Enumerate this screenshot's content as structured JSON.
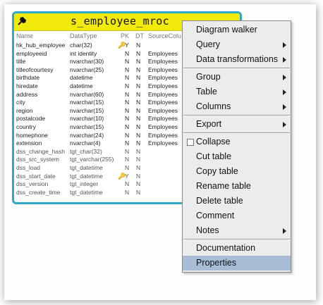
{
  "table": {
    "title": "s_employee_mroc",
    "columns": {
      "name": "Name",
      "datatype": "DataType",
      "pk": "PK",
      "dt": "DT",
      "source": "SourceColu"
    },
    "rows": [
      {
        "name": "hk_hub_employee",
        "type": "char(32)",
        "key": "🔑",
        "pk": "Y",
        "dt": "N",
        "src": ""
      },
      {
        "name": "employeeid",
        "type": "int identity",
        "key": "",
        "pk": "N",
        "dt": "N",
        "src": "Employees"
      },
      {
        "name": "title",
        "type": "nvarchar(30)",
        "key": "",
        "pk": "N",
        "dt": "N",
        "src": "Employees"
      },
      {
        "name": "titleofcourtesy",
        "type": "nvarchar(25)",
        "key": "",
        "pk": "N",
        "dt": "N",
        "src": "Employees"
      },
      {
        "name": "birthdate",
        "type": "datetime",
        "key": "",
        "pk": "N",
        "dt": "N",
        "src": "Employees"
      },
      {
        "name": "hiredate",
        "type": "datetime",
        "key": "",
        "pk": "N",
        "dt": "N",
        "src": "Employees"
      },
      {
        "name": "address",
        "type": "nvarchar(60)",
        "key": "",
        "pk": "N",
        "dt": "N",
        "src": "Employees"
      },
      {
        "name": "city",
        "type": "nvarchar(15)",
        "key": "",
        "pk": "N",
        "dt": "N",
        "src": "Employees"
      },
      {
        "name": "region",
        "type": "nvarchar(15)",
        "key": "",
        "pk": "N",
        "dt": "N",
        "src": "Employees"
      },
      {
        "name": "postalcode",
        "type": "nvarchar(10)",
        "key": "",
        "pk": "N",
        "dt": "N",
        "src": "Employees"
      },
      {
        "name": "country",
        "type": "nvarchar(15)",
        "key": "",
        "pk": "N",
        "dt": "N",
        "src": "Employees"
      },
      {
        "name": "homephone",
        "type": "nvarchar(24)",
        "key": "",
        "pk": "N",
        "dt": "N",
        "src": "Employees"
      },
      {
        "name": "extension",
        "type": "nvarchar(4)",
        "key": "",
        "pk": "N",
        "dt": "N",
        "src": "Employees"
      },
      {
        "name": "dss_change_hash",
        "type": "tgt_char(32)",
        "key": "",
        "pk": "N",
        "dt": "N",
        "src": ""
      },
      {
        "name": "dss_src_system",
        "type": "tgt_varchar(255)",
        "key": "",
        "pk": "N",
        "dt": "N",
        "src": ""
      },
      {
        "name": "dss_load",
        "type": "tgt_datetime",
        "key": "",
        "pk": "N",
        "dt": "N",
        "src": ""
      },
      {
        "name": "dss_start_date",
        "type": "tgt_datetime",
        "key": "🔑",
        "pk": "Y",
        "dt": "N",
        "src": ""
      },
      {
        "name": "dss_version",
        "type": "tgt_integer",
        "key": "",
        "pk": "N",
        "dt": "N",
        "src": ""
      },
      {
        "name": "dss_create_time",
        "type": "tgt_datetime",
        "key": "",
        "pk": "N",
        "dt": "N",
        "src": ""
      }
    ]
  },
  "menu": {
    "items": [
      {
        "label": "Diagram walker",
        "submenu": false
      },
      {
        "label": "Query",
        "submenu": true
      },
      {
        "label": "Data transformations",
        "submenu": true
      },
      {
        "label": "Group",
        "submenu": true
      },
      {
        "label": "Table",
        "submenu": true
      },
      {
        "label": "Columns",
        "submenu": true
      },
      {
        "label": "Export",
        "submenu": true
      },
      {
        "label": "Collapse",
        "submenu": false,
        "checkbox": true
      },
      {
        "label": "Cut table",
        "submenu": false
      },
      {
        "label": "Copy table",
        "submenu": false
      },
      {
        "label": "Rename table",
        "submenu": false
      },
      {
        "label": "Delete table",
        "submenu": false
      },
      {
        "label": "Comment",
        "submenu": false
      },
      {
        "label": "Notes",
        "submenu": true
      },
      {
        "label": "Documentation",
        "submenu": false
      },
      {
        "label": "Properties",
        "submenu": false,
        "selected": true
      }
    ]
  },
  "colors": {
    "header": "#f2ea0a",
    "border": "#2fa9c9",
    "selection": "#a8bcd6"
  }
}
